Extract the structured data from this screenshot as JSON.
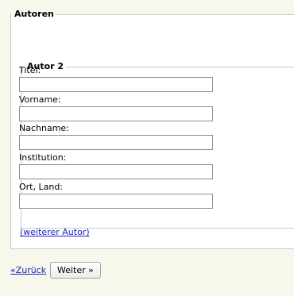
{
  "authors_section": {
    "legend": "Autoren",
    "author": {
      "legend": "Autor 2",
      "fields": [
        {
          "label": "Titel:",
          "value": ""
        },
        {
          "label": "Vorname:",
          "value": ""
        },
        {
          "label": "Nachname:",
          "value": ""
        },
        {
          "label": "Institution:",
          "value": ""
        },
        {
          "label": "Ort, Land:",
          "value": ""
        }
      ]
    },
    "add_author_link": "(weiterer Autor)"
  },
  "navigation": {
    "back_link": "«Zurück",
    "next_button": "Weiter »"
  }
}
